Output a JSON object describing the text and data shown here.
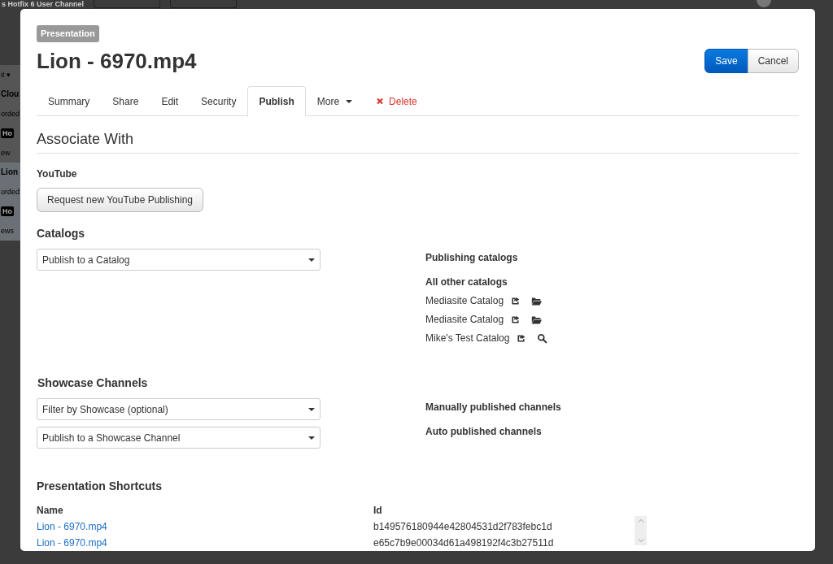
{
  "background_page": {
    "title": "s Hotfix 6 User Channel",
    "fragments": [
      {
        "kind": "menu",
        "text": "it ▾"
      },
      {
        "kind": "title",
        "text": "Clou"
      },
      {
        "kind": "text",
        "text": "orded"
      },
      {
        "kind": "tag",
        "text": "Ho"
      },
      {
        "kind": "text",
        "text": "ew"
      },
      {
        "kind": "title",
        "text": "Lion",
        "selected": true
      },
      {
        "kind": "text",
        "text": "orded",
        "selected": true
      },
      {
        "kind": "tag",
        "text": "Ho",
        "selected": true
      },
      {
        "kind": "text",
        "text": "ews",
        "selected": true
      }
    ]
  },
  "dialog": {
    "badge": "Presentation",
    "title": "Lion - 6970.mp4",
    "buttons": [
      {
        "label": "Save",
        "kind": "primary"
      },
      {
        "label": "Cancel",
        "kind": "default"
      }
    ],
    "tabs": [
      {
        "label": "Summary",
        "selected": false,
        "kind": "tab"
      },
      {
        "label": "Share",
        "selected": false,
        "kind": "tab"
      },
      {
        "label": "Edit",
        "selected": false,
        "kind": "tab"
      },
      {
        "label": "Security",
        "selected": false,
        "kind": "tab"
      },
      {
        "label": "Publish",
        "selected": true,
        "kind": "tab"
      },
      {
        "label": "More",
        "selected": false,
        "kind": "dropdown"
      },
      {
        "label": "Delete",
        "selected": false,
        "kind": "delete"
      }
    ],
    "section_title": "Associate With",
    "youtube": {
      "label": "YouTube",
      "button": "Request new YouTube Publishing"
    },
    "catalogs": {
      "title": "Catalogs",
      "select": "Publish to a Catalog",
      "publishing_label": "Publishing catalogs",
      "other_label": "All other catalogs",
      "items": [
        {
          "name": "Mediasite Catalog",
          "kind": "folder"
        },
        {
          "name": "Mediasite Catalog",
          "kind": "folder"
        },
        {
          "name": "Mike's Test Catalog",
          "kind": "search"
        }
      ]
    },
    "showcase": {
      "title": "Showcase Channels",
      "selects": [
        "Filter by Showcase (optional)",
        "Publish to a Showcase Channel"
      ],
      "manual_label": "Manually published channels",
      "auto_label": "Auto published channels"
    },
    "shortcuts": {
      "title": "Presentation Shortcuts",
      "columns": [
        "Name",
        "Id"
      ],
      "rows": [
        {
          "name": "Lion - 6970.mp4",
          "id": "b149576180944e42804531d2f783febc1d"
        },
        {
          "name": "Lion - 6970.mp4",
          "id": "e65c7b9e00034d61a498192f4c3b27511d"
        }
      ]
    }
  }
}
